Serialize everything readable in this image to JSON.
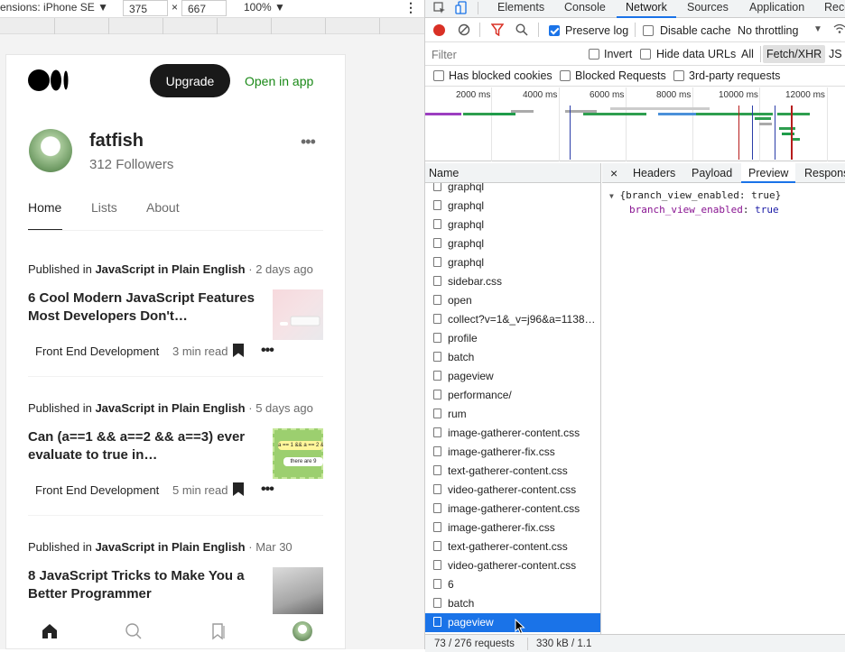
{
  "device_toolbar": {
    "dimensions_label": "ensions: iPhone SE",
    "width": "375",
    "height": "667",
    "times": "×",
    "zoom": "100%"
  },
  "medium": {
    "upgrade": "Upgrade",
    "open_in_app": "Open in app",
    "profile_name": "fatfish",
    "followers": "312 Followers",
    "more": "•••",
    "tabs": [
      "Home",
      "Lists",
      "About"
    ],
    "articles": [
      {
        "published_in": "Published in",
        "publication": "JavaScript in Plain English",
        "ago": "· 2 days ago",
        "title": "6 Cool Modern JavaScript Features Most Developers Don't…",
        "tag": "Front End Development",
        "read": "3 min read",
        "dots": "•••"
      },
      {
        "published_in": "Published in",
        "publication": "JavaScript in Plain English",
        "ago": "· 5 days ago",
        "title": "Can (a==1 && a==2 && a==3) ever evaluate to true in…",
        "tag": "Front End Development",
        "read": "5 min read",
        "dots": "•••",
        "thumb_text_1": "a == 1 && a == 2 && a == 3",
        "thumb_text_2": "there are 9"
      },
      {
        "published_in": "Published in",
        "publication": "JavaScript in Plain English",
        "ago": "· Mar 30",
        "title": "8 JavaScript Tricks to Make You a Better Programmer"
      }
    ]
  },
  "devtools": {
    "tabs": [
      "Elements",
      "Console",
      "Network",
      "Sources",
      "Application",
      "Reco"
    ],
    "toolbar": {
      "preserve_log": "Preserve log",
      "disable_cache": "Disable cache",
      "throttling": "No throttling"
    },
    "filter_bar": {
      "filter_placeholder": "Filter",
      "invert": "Invert",
      "hide_data_urls": "Hide data URLs",
      "all": "All",
      "fetch_xhr": "Fetch/XHR",
      "js": "JS"
    },
    "filter_bar2": {
      "blocked_cookies": "Has blocked cookies",
      "blocked_requests": "Blocked Requests",
      "third_party": "3rd-party requests"
    },
    "overview_ticks": [
      "2000 ms",
      "4000 ms",
      "6000 ms",
      "8000 ms",
      "10000 ms",
      "12000 ms"
    ],
    "list_header": "Name",
    "requests": [
      "graphql",
      "graphql",
      "graphql",
      "graphql",
      "graphql",
      "sidebar.css",
      "open",
      "collect?v=1&_v=j96&a=1138…",
      "profile",
      "batch",
      "pageview",
      "performance/",
      "rum",
      "image-gatherer-content.css",
      "image-gatherer-fix.css",
      "text-gatherer-content.css",
      "video-gatherer-content.css",
      "image-gatherer-content.css",
      "image-gatherer-fix.css",
      "text-gatherer-content.css",
      "video-gatherer-content.css",
      "6",
      "batch",
      "pageview"
    ],
    "selected_index": 23,
    "status": {
      "requests": "73 / 276 requests",
      "size": "330 kB / 1.1"
    },
    "detail_tabs": [
      "×",
      "Headers",
      "Payload",
      "Preview",
      "Respons"
    ],
    "preview": {
      "root": "{branch_view_enabled: true}",
      "key": "branch_view_enabled",
      "colon": ":",
      "value": "true"
    }
  }
}
